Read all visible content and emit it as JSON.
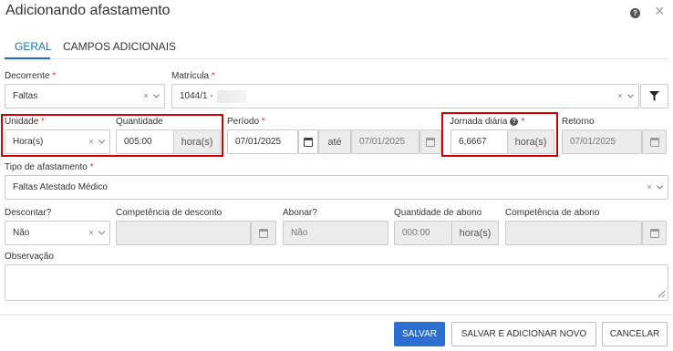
{
  "header": {
    "title": "Adicionando afastamento",
    "help_icon": "?",
    "close_icon": "×"
  },
  "tabs": [
    {
      "label": "GERAL",
      "active": true
    },
    {
      "label": "CAMPOS ADICIONAIS",
      "active": false
    }
  ],
  "fields": {
    "decorrente": {
      "label": "Decorrente",
      "value": "Faltas"
    },
    "matricula": {
      "label": "Matrícula",
      "value": "1044/1 -"
    },
    "unidade": {
      "label": "Unidade",
      "value": "Hora(s)"
    },
    "quantidade": {
      "label": "Quantidade",
      "value": "005:00",
      "unit": "hora(s)"
    },
    "periodo": {
      "label": "Período",
      "start": "07/01/2025",
      "sep": "até",
      "end": "07/01/2025"
    },
    "jornada": {
      "label": "Jornada diária",
      "value": "6,6667",
      "unit": "hora(s)"
    },
    "retorno": {
      "label": "Retorno",
      "value": "07/01/2025"
    },
    "tipo": {
      "label": "Tipo de afastamento",
      "value": "Faltas Atestado Médico"
    },
    "descontar": {
      "label": "Descontar?",
      "value": "Não"
    },
    "competencia_desconto": {
      "label": "Competência de desconto",
      "value": ""
    },
    "abonar": {
      "label": "Abonar?",
      "value": "Não"
    },
    "quantidade_abono": {
      "label": "Quantidade de abono",
      "value": "000:00",
      "unit": "hora(s)"
    },
    "competencia_abono": {
      "label": "Competência de abono",
      "value": ""
    },
    "observacao": {
      "label": "Observação",
      "value": ""
    }
  },
  "required_mark": "*",
  "clear_icon": "×",
  "buttons": {
    "save": "SALVAR",
    "save_new": "SALVAR E ADICIONAR NOVO",
    "cancel": "CANCELAR"
  },
  "colors": {
    "primary": "#2d6fd1",
    "tab_active": "#1f6fbf",
    "highlight": "#d40000",
    "required": "#dd3333"
  }
}
